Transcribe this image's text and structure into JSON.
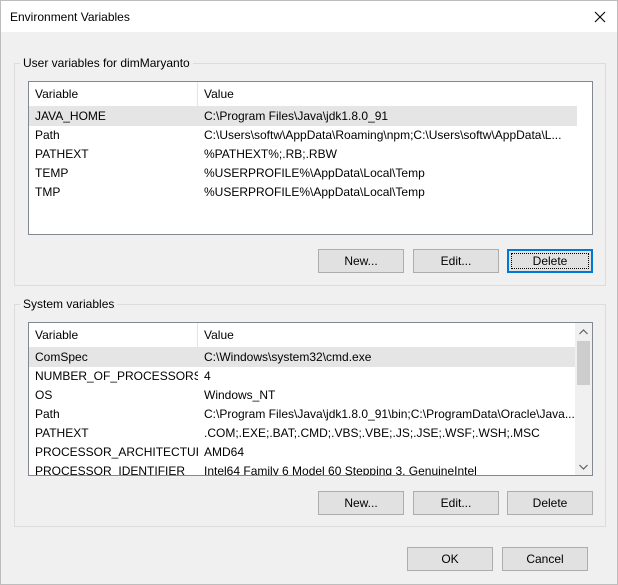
{
  "window": {
    "title": "Environment Variables",
    "close_icon": "close-icon"
  },
  "user_vars": {
    "group_label": "User variables for dimMaryanto",
    "columns": [
      "Variable",
      "Value"
    ],
    "rows": [
      {
        "variable": "JAVA_HOME",
        "value": "C:\\Program Files\\Java\\jdk1.8.0_91"
      },
      {
        "variable": "Path",
        "value": "C:\\Users\\softw\\AppData\\Roaming\\npm;C:\\Users\\softw\\AppData\\L..."
      },
      {
        "variable": "PATHEXT",
        "value": "%PATHEXT%;.RB;.RBW"
      },
      {
        "variable": "TEMP",
        "value": "%USERPROFILE%\\AppData\\Local\\Temp"
      },
      {
        "variable": "TMP",
        "value": "%USERPROFILE%\\AppData\\Local\\Temp"
      }
    ],
    "selected_index": 0,
    "buttons": {
      "new": "New...",
      "edit": "Edit...",
      "delete": "Delete"
    }
  },
  "system_vars": {
    "group_label": "System variables",
    "columns": [
      "Variable",
      "Value"
    ],
    "rows": [
      {
        "variable": "ComSpec",
        "value": "C:\\Windows\\system32\\cmd.exe"
      },
      {
        "variable": "NUMBER_OF_PROCESSORS",
        "value": "4"
      },
      {
        "variable": "OS",
        "value": "Windows_NT"
      },
      {
        "variable": "Path",
        "value": "C:\\Program Files\\Java\\jdk1.8.0_91\\bin;C:\\ProgramData\\Oracle\\Java..."
      },
      {
        "variable": "PATHEXT",
        "value": ".COM;.EXE;.BAT;.CMD;.VBS;.VBE;.JS;.JSE;.WSF;.WSH;.MSC"
      },
      {
        "variable": "PROCESSOR_ARCHITECTURE",
        "value": "AMD64"
      },
      {
        "variable": "PROCESSOR_IDENTIFIER",
        "value": "Intel64 Family 6 Model 60 Stepping 3, GenuineIntel"
      }
    ],
    "selected_index": 0,
    "buttons": {
      "new": "New...",
      "edit": "Edit...",
      "delete": "Delete"
    }
  },
  "footer": {
    "ok": "OK",
    "cancel": "Cancel"
  },
  "colors": {
    "accent": "#0078d7",
    "selection": "#e5e5e5"
  }
}
